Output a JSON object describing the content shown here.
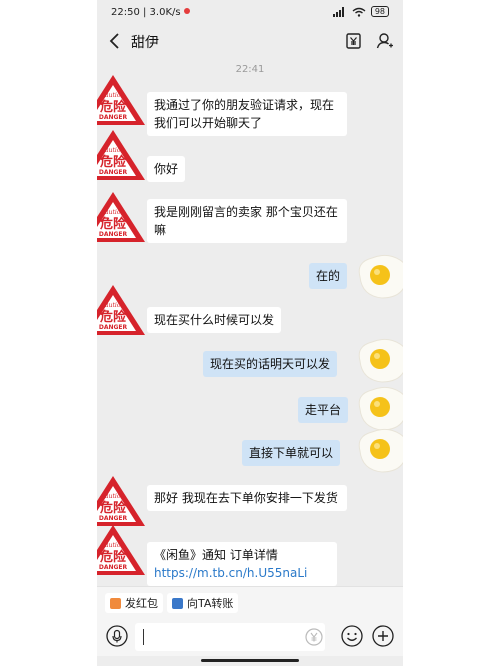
{
  "status_bar": {
    "left_text": "22:50 | 3.0K/s",
    "battery": "98"
  },
  "header": {
    "title": "甜伊",
    "back_icon": "chevron-left-icon",
    "icons": [
      "receipt-yen-icon",
      "user-icon"
    ]
  },
  "chat": {
    "time_separator": "22:41",
    "avatar_label": {
      "top": "caution",
      "main": "危险",
      "bottom": "DANGER"
    },
    "messages": [
      {
        "side": "left",
        "text": "我通过了你的朋友验证请求，现在我们可以开始聊天了"
      },
      {
        "side": "left",
        "text": "你好"
      },
      {
        "side": "left",
        "text": "我是刚刚留言的卖家 那个宝贝还在嘛"
      },
      {
        "side": "right",
        "text": "在的"
      },
      {
        "side": "left",
        "text": "现在买什么时候可以发"
      },
      {
        "side": "right",
        "text": "现在买的话明天可以发"
      },
      {
        "side": "right",
        "text": "走平台"
      },
      {
        "side": "right",
        "text": "直接下单就可以"
      },
      {
        "side": "left",
        "text": "那好  我现在去下单你安排一下发货"
      },
      {
        "side": "left",
        "text": "《闲鱼》通知 订单详情",
        "link": "https://m.tb.cn/h.U55naLi"
      }
    ]
  },
  "quick_actions": [
    {
      "label": "发红包",
      "icon": "red-envelope-icon",
      "color": "#f08a3c"
    },
    {
      "label": "向TA转账",
      "icon": "transfer-icon",
      "color": "#3a78c9"
    }
  ],
  "input": {
    "placeholder": "",
    "icons": [
      "voice-icon",
      "yen-icon",
      "emoji-icon",
      "plus-icon"
    ]
  }
}
